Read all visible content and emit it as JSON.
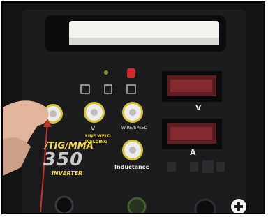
{
  "panel": {
    "voltage_label": "V",
    "current_label": "A",
    "inductance_label": "Inductance",
    "model_number": "350",
    "series_text": "/TIG/MMA",
    "brand_line1": "LINE WELD",
    "brand_line2": "WELDING",
    "inverter_text": "INVERTER",
    "knob_labels": {
      "left_knob": "",
      "v_knob": "V",
      "wire_knob": "WIRE/SPEED"
    },
    "plus_symbol": "+"
  },
  "colors": {
    "panel_dark": "#1c1c1f",
    "frame_dark": "#0e0e10",
    "handle_light": "#f3f3f0",
    "knob_ring": "#d8c237",
    "display_red": "#a8333a",
    "led_red": "#d12a2a",
    "skin": "#e0b59c",
    "pointer": "#c4322f",
    "accent_yellow": "#f2d94a"
  },
  "icons": [
    "pointer-arrow",
    "knob",
    "led-indicator",
    "plus-icon",
    "digital-display"
  ]
}
